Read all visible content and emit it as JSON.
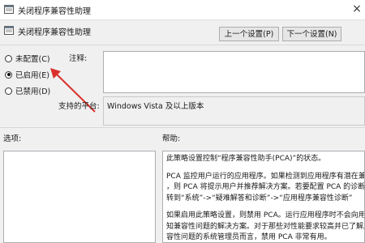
{
  "window": {
    "title": "关闭程序兼容性助理",
    "close_glyph": "×"
  },
  "header": {
    "title": "关闭程序兼容性助理",
    "prev_button": "上一个设置(P)",
    "next_button": "下一个设置(N)"
  },
  "state": {
    "options": [
      {
        "label": "未配置(C)",
        "selected": false
      },
      {
        "label": "已启用(E)",
        "selected": true
      },
      {
        "label": "已禁用(D)",
        "selected": false
      }
    ]
  },
  "comment": {
    "label": "注释:",
    "value": ""
  },
  "platform": {
    "label": "支持的平台:",
    "value": "Windows Vista 及以上版本"
  },
  "options_panel": {
    "label": "选项:"
  },
  "help_panel": {
    "label": "帮助:",
    "lines": [
      "此策略设置控制“程序兼容性助手(PCA)”的状态。",
      "PCA 监控用户运行的应用程序。如果检测到应用程序有潜在兼容",
      "，则 PCA 将提示用户并推荐解决方案。若要配置 PCA 的诊断设",
      "转到“系统”->“疑难解答和诊断”->“应用程序兼容性诊断”",
      "如果启用此策略设置，则禁用 PCA。运行应用程序时不会向用户",
      "知兼容性问题的解决方案。对于那些对性能要求较高并已了解应用",
      "容性问题的系统管理员而言，禁用 PCA 非常有用。"
    ]
  },
  "colors": {
    "arrow": "#d9302b"
  }
}
